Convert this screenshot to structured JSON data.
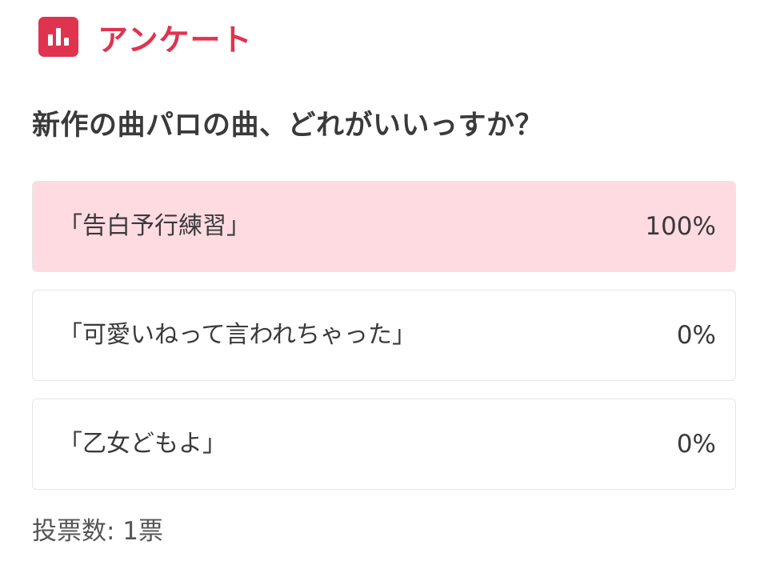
{
  "poll": {
    "header_title": "アンケート",
    "header_icon": "bar-chart-icon",
    "accent_color": "#e0334f",
    "question": "新作の曲パロの曲、どれがいいっすか？",
    "options": [
      {
        "label": "「告白予行練習」",
        "percent_text": "100%",
        "percent": 100
      },
      {
        "label": "「可愛いねって言われちゃった」",
        "percent_text": "0%",
        "percent": 0
      },
      {
        "label": "「乙女どもよ」",
        "percent_text": "0%",
        "percent": 0
      }
    ],
    "fill_color": "#fedbe1",
    "vote_count": "投票数: 1票"
  }
}
